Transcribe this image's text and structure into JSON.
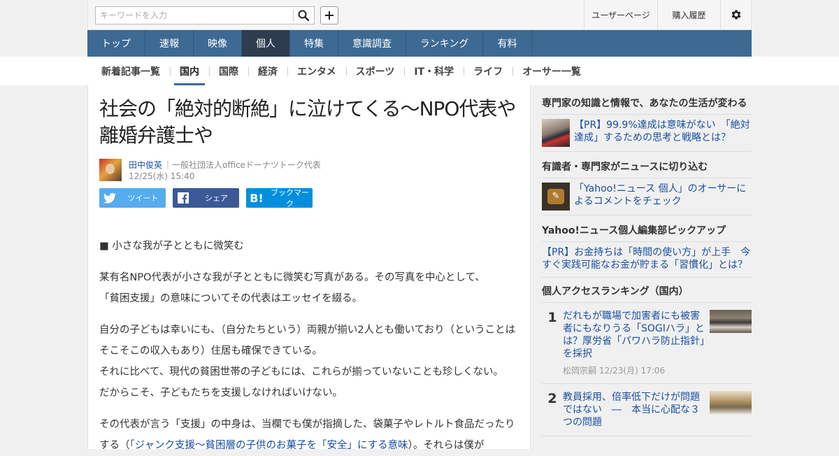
{
  "header": {
    "search_placeholder": "キーワードを入力",
    "user_page": "ユーザーページ",
    "purchase_history": "購入履歴"
  },
  "global_nav": [
    "トップ",
    "速報",
    "映像",
    "個人",
    "特集",
    "意識調査",
    "ランキング",
    "有料"
  ],
  "global_nav_active": "個人",
  "category_nav": [
    "新着記事一覧",
    "国内",
    "国際",
    "経済",
    "エンタメ",
    "スポーツ",
    "IT・科学",
    "ライフ",
    "オーサー一覧"
  ],
  "category_nav_active": "国内",
  "article": {
    "title": "社会の「絶対的断絶」に泣けてくる～NPO代表や離婚弁護士や",
    "author_name": "田中俊英",
    "author_role": "｜一般社団法人officeドーナツトーク代表",
    "date": "12/25(水) 15:40",
    "share": {
      "tweet": "ツイート",
      "facebook": "シェア",
      "bookmark": "ブックマーク"
    },
    "p1": "■ 小さな我が子とともに微笑む",
    "p2a": "某有名NPO代表が小さな我が子とともに微笑む写真がある。その写真を中心として、",
    "p2b": "「貧困支援」の意味についてその代表はエッセイを綴る。",
    "p3a": "自分の子どもは幸いにも、（自分たちという）両親が揃い2人とも働いており（ということはそこそこの収入もあり）住居も確保できている。",
    "p3b": "それに比べて、現代の貧困世帯の子どもには、これらが揃っていないことも珍しくない。",
    "p3c": "だからこそ、子どもたちを支援しなければいけない。",
    "p4a": "その代表が言う「支援」の中身は、当欄でも僕が指摘した、袋菓子やレトルト食品だったりする（",
    "p4link1": "「ジャンク支援～貧困層の子供のお菓子を「安全」にする意味",
    "p4b": "）。それらは僕が"
  },
  "sidebar": {
    "s1_head": "専門家の知識と情報で、あなたの生活が変わる",
    "s1_link": "【PR】99.9%達成は意味がない　「絶対達成」するための思考と戦略とは？",
    "s2_head": "有識者・専門家がニュースに切り込む",
    "s2_link": "「Yahoo!ニュース 個人」のオーサーによるコメントをチェック",
    "s3_head": "Yahoo!ニュース個人編集部ピックアップ",
    "s3_link": "【PR】お金持ちは「時間の使い方」が上手　今すぐ実践可能なお金が貯まる「習慣化」とは？",
    "s4_head": "個人アクセスランキング（国内）",
    "ranking": [
      {
        "rank": "1",
        "title": "だれもが職場で加害者にも被害者にもなりうる「SOGIハラ」とは？厚労省「パワハラ防止指針」を採択",
        "meta": "松岡宗嗣 12/23(月) 17:06"
      },
      {
        "rank": "2",
        "title": "教員採用、倍率低下だけが問題ではない　―　本当に心配な３つの問題",
        "meta": ""
      }
    ]
  }
}
